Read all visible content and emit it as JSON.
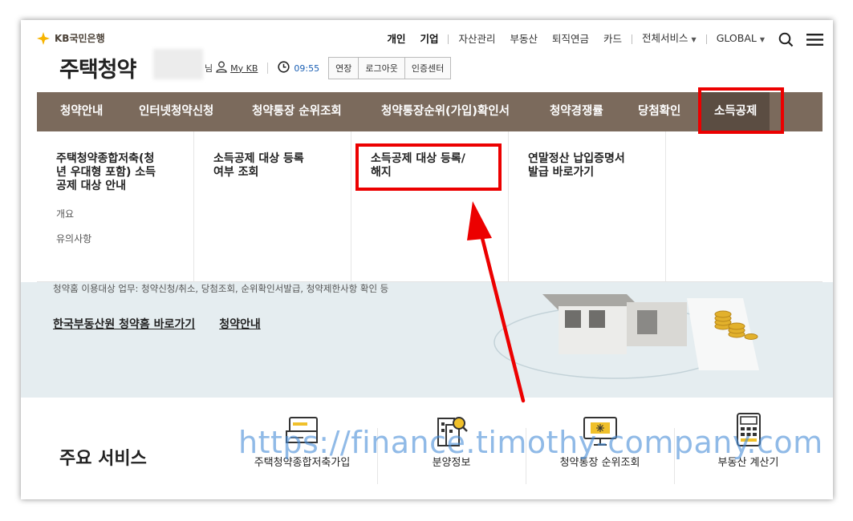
{
  "brand": {
    "logo_text": "KB국민은행",
    "accent": "#7b6a5c",
    "accent_dark": "#5b4d42",
    "logo_star": "#f7b400"
  },
  "top_nav": {
    "items": [
      "개인",
      "기업",
      "자산관리",
      "부동산",
      "퇴직연금",
      "카드",
      "전체서비스",
      "GLOBAL"
    ],
    "search_icon": "search-icon",
    "menu_icon": "hamburger-menu-icon"
  },
  "header": {
    "title": "주택청약",
    "user_suffix": "님",
    "my_kb": "My KB",
    "session_time": "09:55",
    "buttons": [
      "연장",
      "로그아웃",
      "인증센터"
    ]
  },
  "main_nav": {
    "items": [
      "청약안내",
      "인터넷청약신청",
      "청약통장 순위조회",
      "청약통장순위(가입)확인서",
      "청약경쟁률",
      "당첨확인",
      "소득공제"
    ],
    "active": "소득공제"
  },
  "mega_menu": {
    "columns": [
      {
        "title": "주택청약종합저축(청년 우대형 포함) 소득공제 대상 안내",
        "title_lines": [
          "주택청약종합저축(청",
          "년 우대형 포함) 소득",
          "공제 대상 안내"
        ],
        "subitems": [
          "개요",
          "유의사항"
        ]
      },
      {
        "title": "소득공제 대상 등록 여부 조회",
        "title_lines": [
          "소득공제 대상 등록",
          "여부 조회"
        ],
        "subitems": []
      },
      {
        "title": "소득공제 대상 등록/해지",
        "title_lines": [
          "소득공제 대상 등록/",
          "해지"
        ],
        "subitems": []
      },
      {
        "title": "연말정산 납입증명서 발급 바로가기",
        "title_lines": [
          "연말정산 납입증명서",
          "발급 바로가기"
        ],
        "subitems": []
      }
    ]
  },
  "hero": {
    "description": "청약홈 이용대상 업무: 청약신청/취소, 당첨조회, 순위확인서발급, 청약제한사항 확인 등",
    "links": [
      "한국부동산원 청약홈 바로가기",
      "청약안내"
    ]
  },
  "services": {
    "title": "주요 서비스",
    "items": [
      {
        "label": "주택청약종합저축가입",
        "icon": "card-signup-icon"
      },
      {
        "label": "분양정보",
        "icon": "building-search-icon"
      },
      {
        "label": "청약통장 순위조회",
        "icon": "monitor-rank-icon"
      },
      {
        "label": "부동산 계산기",
        "icon": "calculator-icon"
      }
    ]
  },
  "annotation": {
    "highlight_color": "#ec0000",
    "watermark": "https://finance.timothy-company.com"
  }
}
